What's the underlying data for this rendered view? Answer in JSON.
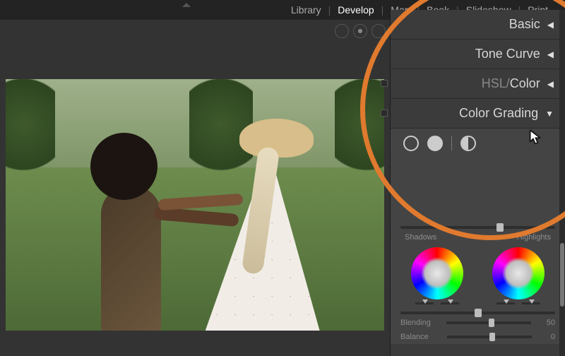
{
  "nav": {
    "items": [
      "Library",
      "Develop",
      "Map",
      "Book",
      "Slideshow",
      "Print"
    ],
    "active_index": 1
  },
  "panels": {
    "basic": {
      "label": "Basic",
      "expanded": false
    },
    "tone_curve": {
      "label": "Tone Curve",
      "expanded": false
    },
    "hsl_color": {
      "label_hsl": "HSL",
      "label_sep": " / ",
      "label_color": "Color",
      "expanded": false
    },
    "color_grading": {
      "label": "Color Grading",
      "expanded": true,
      "adjust_icons": [
        "three-way-icon",
        "shadows-solo-icon",
        "midtones-solo-icon"
      ],
      "top_slider_pct": 62,
      "sections": {
        "shadows": {
          "label": "Shadows",
          "hue": 0,
          "sat": 0,
          "lum_slider_pct": 50,
          "sat_slider_pct": 50
        },
        "highlights": {
          "label": "Highlights",
          "hue": 0,
          "sat": 0,
          "lum_slider_pct": 50,
          "sat_slider_pct": 50
        }
      },
      "blending": {
        "label": "Blending",
        "value": 50,
        "slider_pct": 50
      },
      "balance": {
        "label": "Balance",
        "value": 0,
        "slider_pct": 50
      }
    }
  },
  "glyphs": {
    "tri_left": "◀",
    "tri_down": "▼"
  },
  "highlight": {
    "color": "#e07a2e"
  }
}
